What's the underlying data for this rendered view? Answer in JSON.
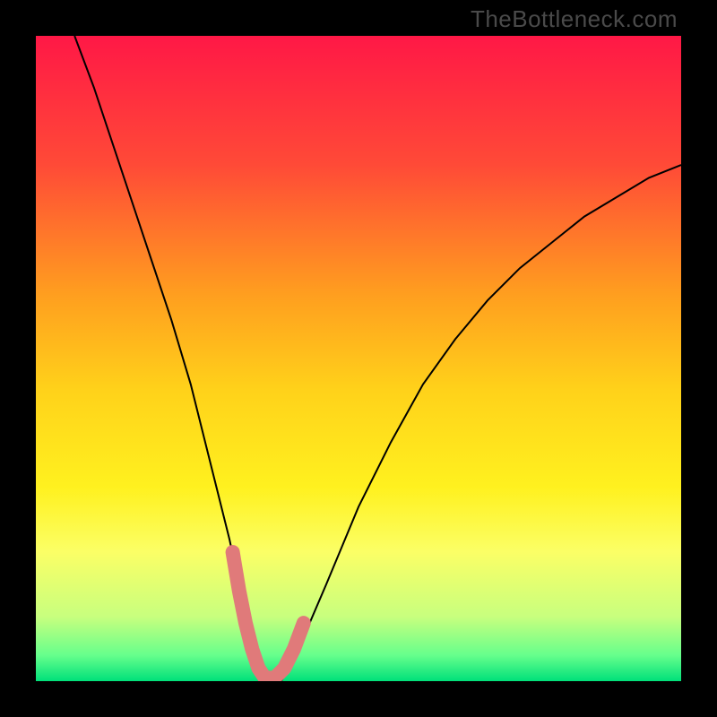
{
  "watermark": {
    "text": "TheBottleneck.com"
  },
  "chart_data": {
    "type": "line",
    "title": "",
    "xlabel": "",
    "ylabel": "",
    "xlim": [
      0,
      100
    ],
    "ylim": [
      0,
      100
    ],
    "axes_visible": false,
    "grid": false,
    "background_gradient": {
      "stops": [
        {
          "offset": 0.0,
          "color": "#ff1846"
        },
        {
          "offset": 0.2,
          "color": "#ff4a37"
        },
        {
          "offset": 0.4,
          "color": "#ff9e1f"
        },
        {
          "offset": 0.55,
          "color": "#ffd21a"
        },
        {
          "offset": 0.7,
          "color": "#fff11f"
        },
        {
          "offset": 0.8,
          "color": "#fbff66"
        },
        {
          "offset": 0.9,
          "color": "#c8ff7e"
        },
        {
          "offset": 0.96,
          "color": "#66ff8c"
        },
        {
          "offset": 1.0,
          "color": "#00e07a"
        }
      ]
    },
    "series": [
      {
        "name": "bottleneck-curve",
        "stroke": "#000000",
        "stroke_width": 2,
        "x": [
          6,
          9,
          12,
          15,
          18,
          21,
          24,
          26,
          28,
          30,
          31.5,
          33,
          34,
          35,
          36,
          38,
          40,
          42,
          45,
          50,
          55,
          60,
          65,
          70,
          75,
          80,
          85,
          90,
          95,
          100
        ],
        "y": [
          100,
          92,
          83,
          74,
          65,
          56,
          46,
          38,
          30,
          22,
          15,
          8,
          4,
          1,
          0,
          0,
          3,
          8,
          15,
          27,
          37,
          46,
          53,
          59,
          64,
          68,
          72,
          75,
          78,
          80
        ]
      },
      {
        "name": "optimal-band",
        "type": "marker-band",
        "stroke": "#e07a7a",
        "stroke_width": 10,
        "x": [
          30.5,
          31.5,
          32.5,
          33.5,
          34.5,
          35.5,
          37,
          38.5,
          40,
          41.5
        ],
        "y": [
          20,
          14,
          9,
          5,
          2,
          0.5,
          0.5,
          2,
          5,
          9
        ]
      }
    ]
  }
}
